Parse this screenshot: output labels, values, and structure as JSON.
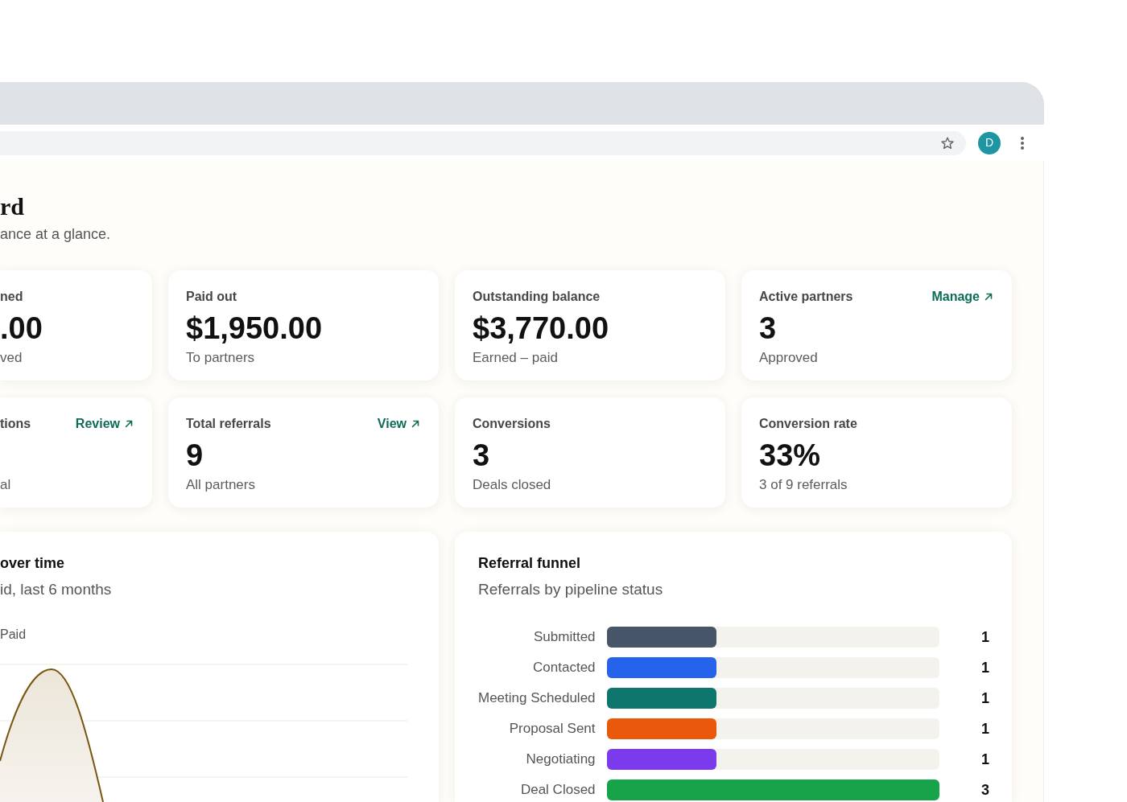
{
  "browser": {
    "avatar": "D"
  },
  "page": {
    "title": "rd",
    "subtitle": "ance at a glance."
  },
  "stat_cards": [
    {
      "label": "ned",
      "value": ".00",
      "note": "ved"
    },
    {
      "label": "Paid out",
      "value": "$1,950.00",
      "note": "To partners"
    },
    {
      "label": "Outstanding balance",
      "value": "$3,770.00",
      "note": "Earned – paid"
    },
    {
      "label": "Active partners",
      "value": "3",
      "note": "Approved",
      "link": "Manage"
    },
    {
      "label": "tions",
      "note": "al",
      "link": "Review"
    },
    {
      "label": "Total referrals",
      "value": "9",
      "note": "All partners",
      "link": "View"
    },
    {
      "label": "Conversions",
      "value": "3",
      "note": "Deals closed"
    },
    {
      "label": "Conversion rate",
      "value": "33%",
      "note": "3 of 9 referrals"
    }
  ],
  "earnings_chart": {
    "title": "over time",
    "subtitle": "id, last 6 months",
    "legend": "Paid"
  },
  "funnel": {
    "title": "Referral funnel",
    "subtitle": "Referrals by pipeline status",
    "rows": [
      {
        "label": "Submitted",
        "count": "1",
        "level": 0.33,
        "color": "#475569"
      },
      {
        "label": "Contacted",
        "count": "1",
        "level": 0.33,
        "color": "#2563eb"
      },
      {
        "label": "Meeting Scheduled",
        "count": "1",
        "level": 0.33,
        "color": "#0f766e"
      },
      {
        "label": "Proposal Sent",
        "count": "1",
        "level": 0.33,
        "color": "#ea580c"
      },
      {
        "label": "Negotiating",
        "count": "1",
        "level": 0.33,
        "color": "#7c3aed"
      },
      {
        "label": "Deal Closed",
        "count": "3",
        "level": 1,
        "color": "#16a34a"
      }
    ]
  }
}
